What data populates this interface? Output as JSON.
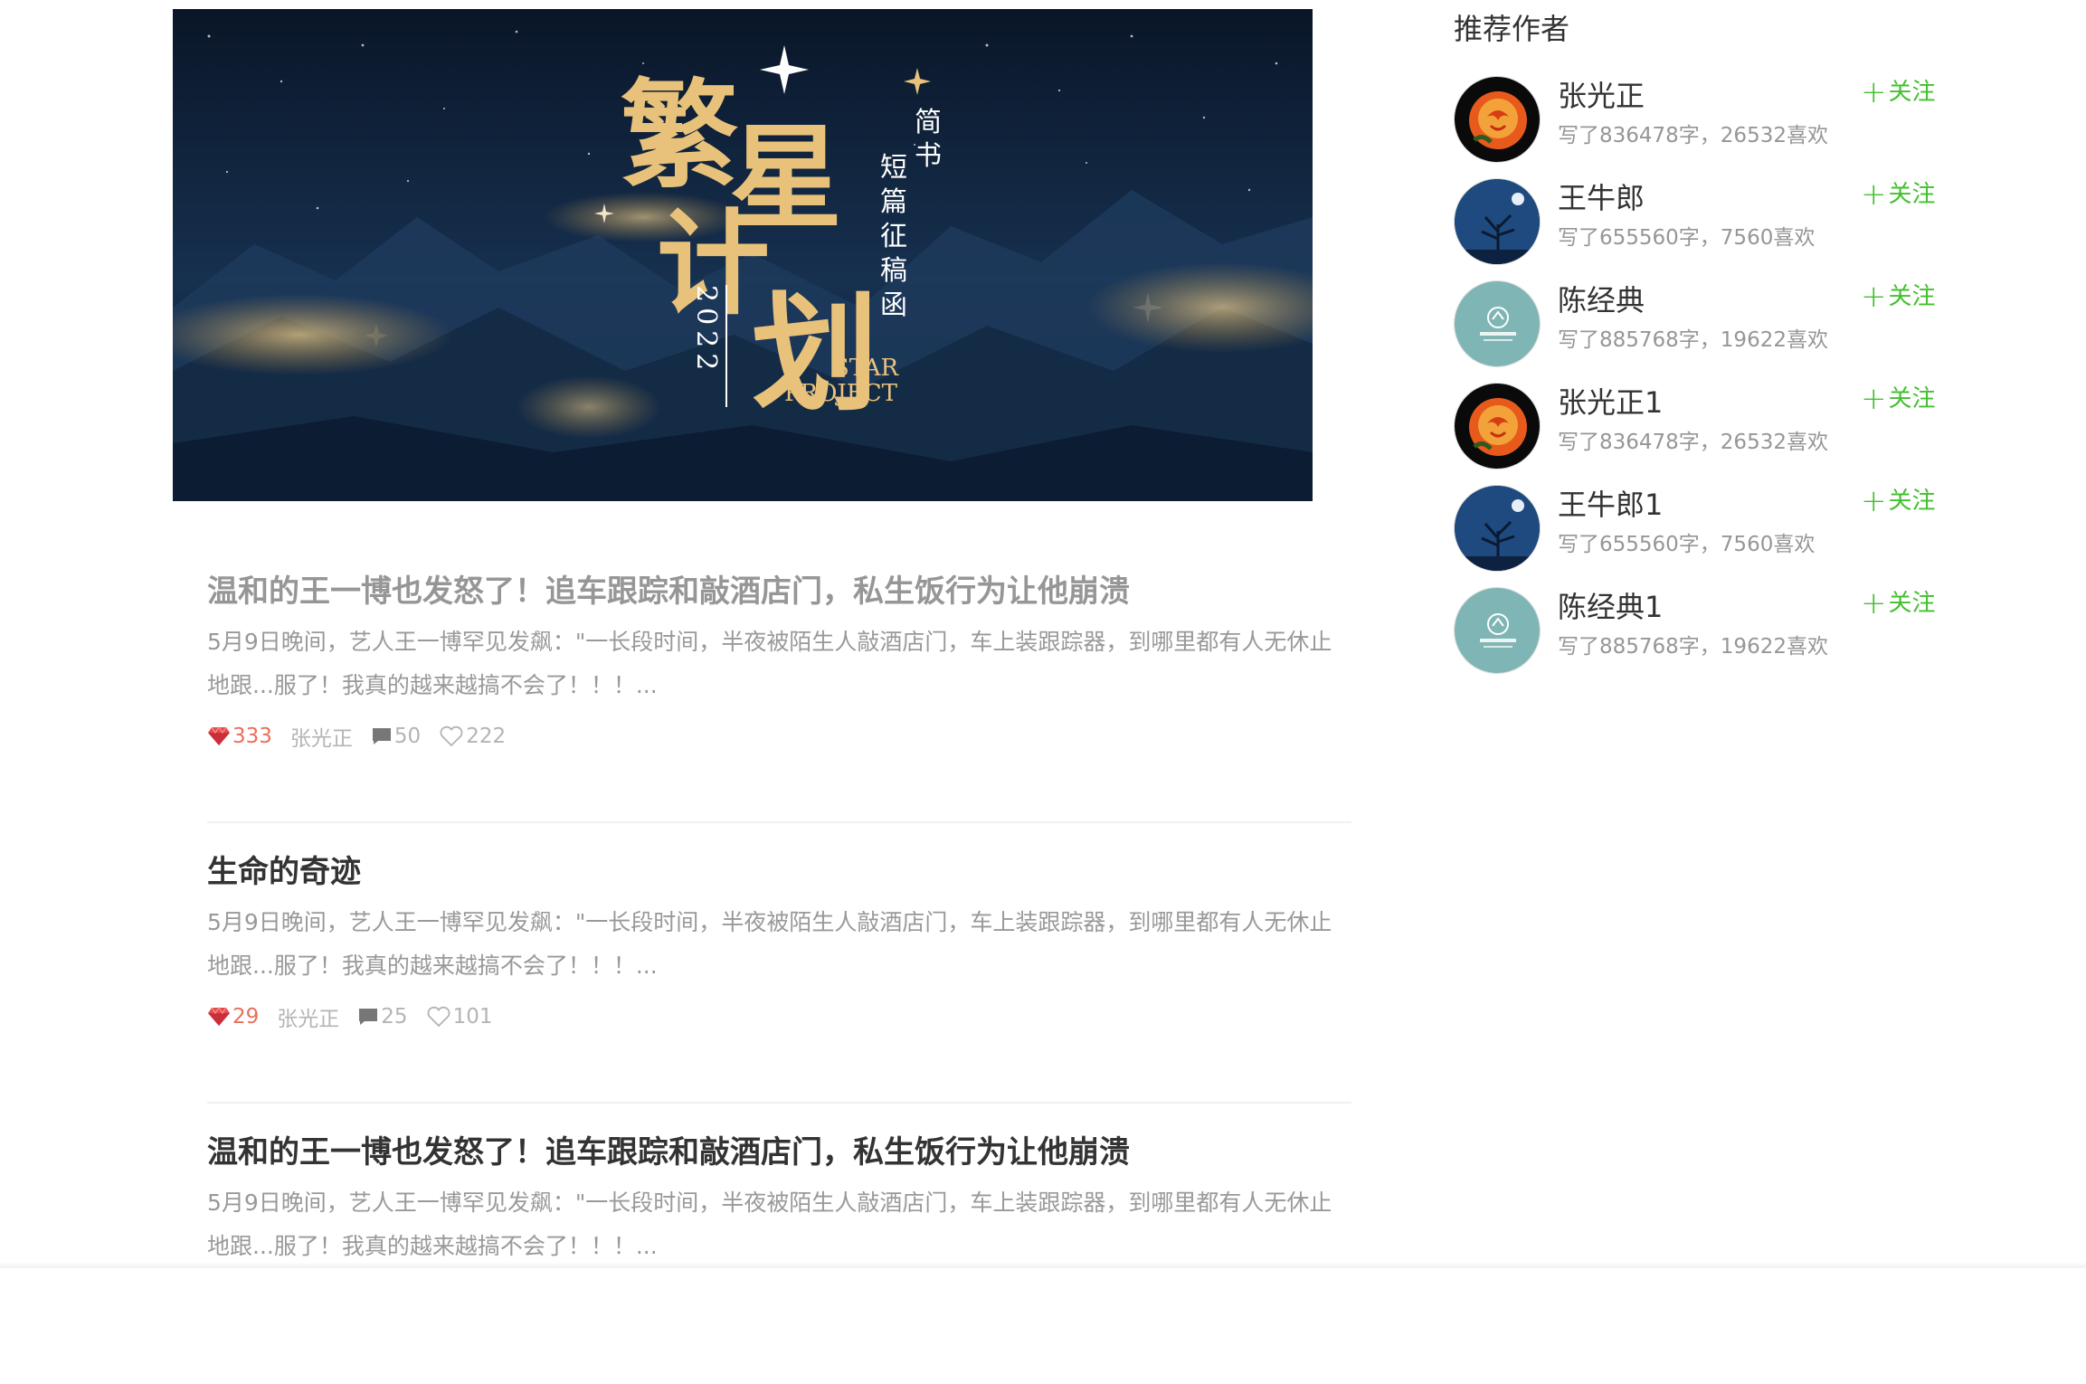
{
  "banner": {
    "title_chars": [
      "繁",
      "星",
      "计",
      "划"
    ],
    "publisher": "简书",
    "subtitle": "短篇征稿函",
    "year": "2022",
    "english": [
      "STAR",
      "PROJECT"
    ]
  },
  "articles": [
    {
      "title": "温和的王一博也发怒了！追车跟踪和敲酒店门，私生饭行为让他崩溃",
      "abstract": "5月9日晚间，艺人王一博罕见发飙：\"一长段时间，半夜被陌生人敲酒店门，车上装跟踪器，到哪里都有人无休止地跟...服了！我真的越来越搞不会了！！！...",
      "diamond": "333",
      "author": "张光正",
      "comments": "50",
      "likes": "222",
      "visited": true
    },
    {
      "title": "生命的奇迹",
      "abstract": "5月9日晚间，艺人王一博罕见发飙：\"一长段时间，半夜被陌生人敲酒店门，车上装跟踪器，到哪里都有人无休止地跟...服了！我真的越来越搞不会了！！！...",
      "diamond": "29",
      "author": "张光正",
      "comments": "25",
      "likes": "101",
      "visited": false
    },
    {
      "title": "温和的王一博也发怒了！追车跟踪和敲酒店门，私生饭行为让他崩溃",
      "abstract": "5月9日晚间，艺人王一博罕见发飙：\"一长段时间，半夜被陌生人敲酒店门，车上装跟踪器，到哪里都有人无休止地跟...服了！我真的越来越搞不会了！！！...",
      "visited": false
    }
  ],
  "sidebar": {
    "title": "推荐作者",
    "follow_label": "关注",
    "authors": [
      {
        "name": "张光正",
        "stats": "写了836478字，26532喜欢",
        "avatar": "rose"
      },
      {
        "name": "王牛郎",
        "stats": "写了655560字，7560喜欢",
        "avatar": "night-tree"
      },
      {
        "name": "陈经典",
        "stats": "写了885768字，19622喜欢",
        "avatar": "teal-logo"
      },
      {
        "name": "张光正1",
        "stats": "写了836478字，26532喜欢",
        "avatar": "rose"
      },
      {
        "name": "王牛郎1",
        "stats": "写了655560字，7560喜欢",
        "avatar": "night-tree"
      },
      {
        "name": "陈经典1",
        "stats": "写了885768字，19622喜欢",
        "avatar": "teal-logo"
      }
    ]
  },
  "colors": {
    "follow_green": "#42c02e",
    "diamond_red": "#ea6f5a",
    "banner_bg": "#0d1c33",
    "banner_gold": "#e8c27a"
  }
}
